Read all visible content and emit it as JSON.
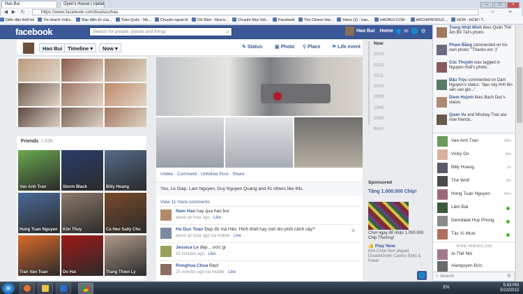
{
  "browser": {
    "tabs": [
      {
        "label": "Hao Bui"
      },
      {
        "label": "Oyen's House | Updat"
      }
    ],
    "url": "https://www.facebook.com/buiducchao",
    "bookmarks": [
      "Diễn đàn thiết kế",
      "Tin nhanh VnEx..",
      "Báo điện tử của...",
      "Toàn Quốc - Nồ...",
      "Chuyện ngoài lề",
      "OS Mart - Mua b...",
      "Chuyện Mục Kiế...",
      "Facebook",
      "The Citizen Hot...",
      "Inbox (2) - hao...",
      "HAOBUI.COM -",
      "ARCHIPRODUC...",
      "HCM - HCM / T..."
    ]
  },
  "fbbar": {
    "logo": "facebook",
    "search_placeholder": "Search for people, places and things",
    "user": "Hao Bui",
    "home": "Home"
  },
  "timeline": {
    "name_btn": "Hao Bui",
    "timeline_btn": "Timeline",
    "now_btn": "Now",
    "nav": [
      "Status",
      "Photo",
      "Place",
      "Life event"
    ],
    "years": [
      "Now",
      "2013",
      "2012",
      "2011",
      "2010",
      "2009",
      "1995",
      "1992",
      "Born"
    ]
  },
  "friends": {
    "title": "Friends",
    "count": "2,636",
    "items": [
      "Van Anh Tran",
      "Storm Black",
      "Billy Hoang",
      "Hung Tuan Nguyen",
      "Kim Thuy",
      "Cá Heo Sally Chu",
      "Tran Van Tuan",
      "Do Hai",
      "Trang Thien Ly"
    ]
  },
  "post": {
    "actions": [
      "Unlike",
      "Comment",
      "Unfollow Post",
      "Share"
    ],
    "likes": "You, Le Giap, Lam Nguyen, Duy Nguyen Quang and 41 others like this.",
    "view_more": "View 11 more comments",
    "comments": [
      {
        "name": "Nam Hao",
        "text": "hay qua hao bui",
        "time": "about an hour ago",
        "like": "Like"
      },
      {
        "name": "Ho Duc Toan",
        "text": "Đẹp đó mà Hảo. Hình thiết hay mới lên phối cảnh vậy?",
        "time": "about an hour ago via mobile",
        "like": "Like"
      },
      {
        "name": "Jessica Le",
        "text": "đẹp... ước gì",
        "time": "32 minutes ago",
        "like": "Like"
      },
      {
        "name": "Ronghua Chua",
        "text": "Đẹp!",
        "time": "25 minutes ago via mobile",
        "like": "Like"
      }
    ]
  },
  "ad": {
    "sponsored": "Sponsored",
    "title": "Tặng 1.000.000 Chip!",
    "text": "Chơi ngay để nhận 1.000.000 Chip Thưởng!",
    "play": "Play Now",
    "sub": "Kim Chon Non played DoubleDown Casino Slots & Poker"
  },
  "ticker": [
    {
      "name": "Trang Nhật Minh",
      "text": "likes Quân Thế Âm Bồ Tát's photo."
    },
    {
      "name": "Phạm Bằng",
      "text": "commented on his own photo: \"Thanks em :)\""
    },
    {
      "name": "Cúc Thuyên",
      "text": "was tagged in Nguyen Huế's photo."
    },
    {
      "name": "Đậu Trọc",
      "text": "commented on Dam Nguyen's status: \"dạo này tính lên sân vào giờ...\""
    },
    {
      "name": "Diem Huỳnh",
      "text": "likes Bach Duc's status."
    },
    {
      "name": "Quan Vu",
      "text": "and Nhuhay Tran are now friends."
    }
  ],
  "chat": {
    "items": [
      {
        "name": "Van Anh Tran",
        "status": "28m"
      },
      {
        "name": "Vicky Do",
        "status": "5m"
      },
      {
        "name": "Billy Hoang",
        "status": "1h"
      },
      {
        "name": "The Wolf",
        "status": "2m"
      },
      {
        "name": "Hong Tuan Nguyen",
        "status": "40m"
      },
      {
        "name": "Lâm Đạt",
        "status": ""
      },
      {
        "name": "Demdalat Huy Phong",
        "status": ""
      },
      {
        "name": "Tác Xì Muoi",
        "status": ""
      }
    ],
    "more_label": "MORE FRIENDS (100)",
    "more": [
      {
        "name": "Ai Thế Nhi"
      },
      {
        "name": "Alanguyen Đức"
      }
    ],
    "search": "Search"
  },
  "taskbar": {
    "lang": "EN",
    "time": "5:43 PM",
    "date": "5/10/2013"
  }
}
